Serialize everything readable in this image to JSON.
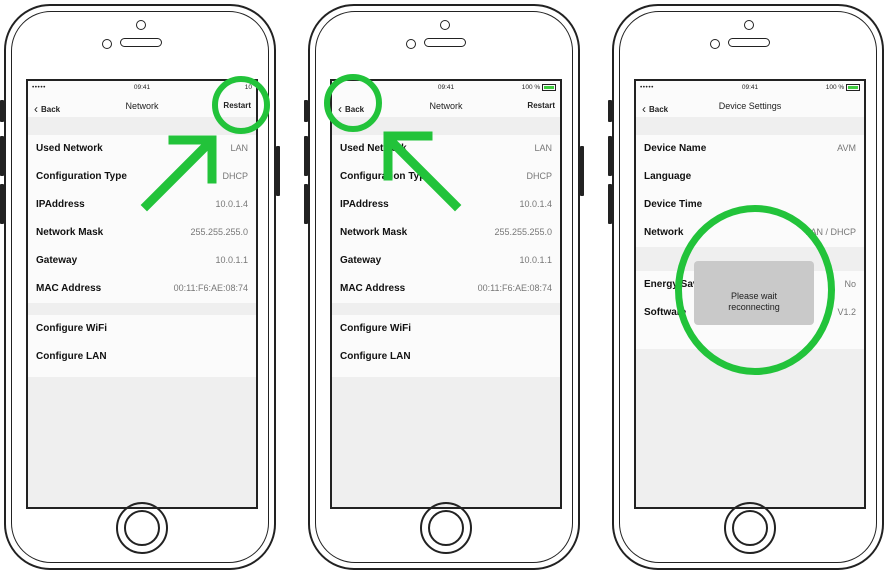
{
  "colors": {
    "highlight": "#22c33a",
    "battery": "#3fcc3f"
  },
  "screens": [
    {
      "status": {
        "signal": "•••••",
        "time": "09:41",
        "battery": "10"
      },
      "nav": {
        "back": "Back",
        "title": "Network",
        "right": "Restart"
      },
      "rows": [
        {
          "label": "Used Network",
          "value": "LAN"
        },
        {
          "label": "Configuration Type",
          "value": "DHCP"
        },
        {
          "label": "IPAddress",
          "value": "10.0.1.4"
        },
        {
          "label": "Network Mask",
          "value": "255.255.255.0"
        },
        {
          "label": "Gateway",
          "value": "10.0.1.1"
        },
        {
          "label": "MAC Address",
          "value": "00:11:F6:AE:08:74"
        }
      ],
      "actions": [
        "Configure WiFi",
        "Configure LAN"
      ]
    },
    {
      "status": {
        "signal": "",
        "time": "09:41",
        "battery": "100 %"
      },
      "nav": {
        "back": "Back",
        "title": "Network",
        "right": "Restart"
      },
      "rows": [
        {
          "label": "Used Network",
          "value": "LAN"
        },
        {
          "label": "Configuration Type",
          "value": "DHCP"
        },
        {
          "label": "IPAddress",
          "value": "10.0.1.4"
        },
        {
          "label": "Network Mask",
          "value": "255.255.255.0"
        },
        {
          "label": "Gateway",
          "value": "10.0.1.1"
        },
        {
          "label": "MAC Address",
          "value": "00:11:F6:AE:08:74"
        }
      ],
      "actions": [
        "Configure WiFi",
        "Configure LAN"
      ]
    },
    {
      "status": {
        "signal": "•••••",
        "time": "09:41",
        "battery": "100 %"
      },
      "nav": {
        "back": "Back",
        "title": "Device Settings",
        "right": ""
      },
      "rows": [
        {
          "label": "Device Name",
          "value": "AVM"
        },
        {
          "label": "Language",
          "value": ""
        },
        {
          "label": "Device Time",
          "value": ""
        },
        {
          "label": "Network",
          "value": "LAN / DHCP"
        },
        {
          "label": "Energy Saving",
          "value": "No"
        },
        {
          "label": "Software",
          "value": "V1.2"
        }
      ],
      "dialog": {
        "line1": "Please wait",
        "line2": "reconnecting"
      }
    }
  ]
}
